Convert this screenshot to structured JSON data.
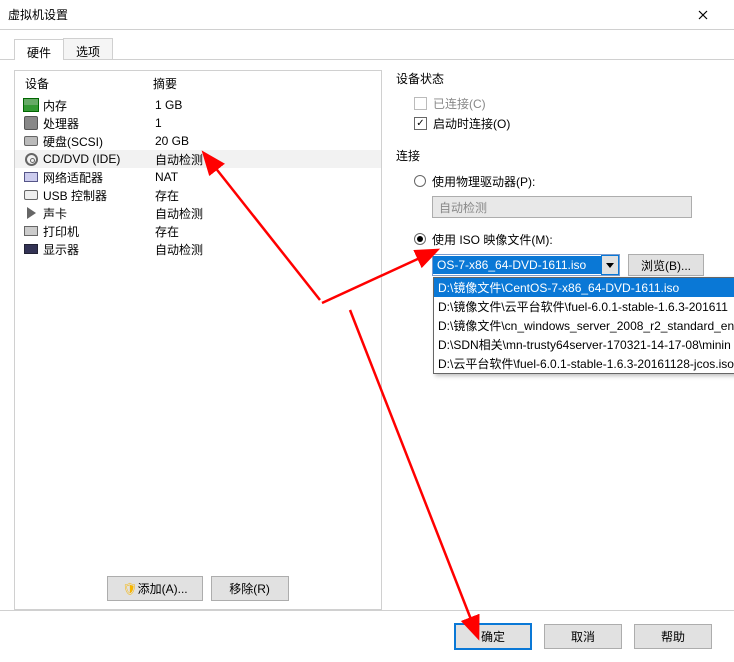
{
  "window_title": "虚拟机设置",
  "tabs": {
    "hardware": "硬件",
    "options": "选项"
  },
  "table": {
    "device_col": "设备",
    "summary_col": "摘要"
  },
  "devices": [
    {
      "name": "内存",
      "summary": "1 GB"
    },
    {
      "name": "处理器",
      "summary": "1"
    },
    {
      "name": "硬盘(SCSI)",
      "summary": "20 GB"
    },
    {
      "name": "CD/DVD (IDE)",
      "summary": "自动检测"
    },
    {
      "name": "网络适配器",
      "summary": "NAT"
    },
    {
      "name": "USB 控制器",
      "summary": "存在"
    },
    {
      "name": "声卡",
      "summary": "自动检测"
    },
    {
      "name": "打印机",
      "summary": "存在"
    },
    {
      "name": "显示器",
      "summary": "自动检测"
    }
  ],
  "selected_index": 3,
  "left_buttons": {
    "add": "添加(A)...",
    "remove": "移除(R)"
  },
  "status_group": {
    "title": "设备状态",
    "connected": "已连接(C)",
    "connect_at_poweron": "启动时连接(O)"
  },
  "conn_group": {
    "title": "连接",
    "use_physical": "使用物理驱动器(P):",
    "auto_detect": "自动检测",
    "use_iso": "使用 ISO 映像文件(M):",
    "iso_value": "OS-7-x86_64-DVD-1611.iso",
    "browse": "浏览(B)...",
    "options": [
      "D:\\镜像文件\\CentOS-7-x86_64-DVD-1611.iso",
      "D:\\镜像文件\\云平台软件\\fuel-6.0.1-stable-1.6.3-201611",
      "D:\\镜像文件\\cn_windows_server_2008_r2_standard_en",
      "D:\\SDN相关\\mn-trusty64server-170321-14-17-08\\minin",
      "D:\\云平台软件\\fuel-6.0.1-stable-1.6.3-20161128-jcos.iso"
    ]
  },
  "footer": {
    "ok": "确定",
    "cancel": "取消",
    "help": "帮助"
  }
}
